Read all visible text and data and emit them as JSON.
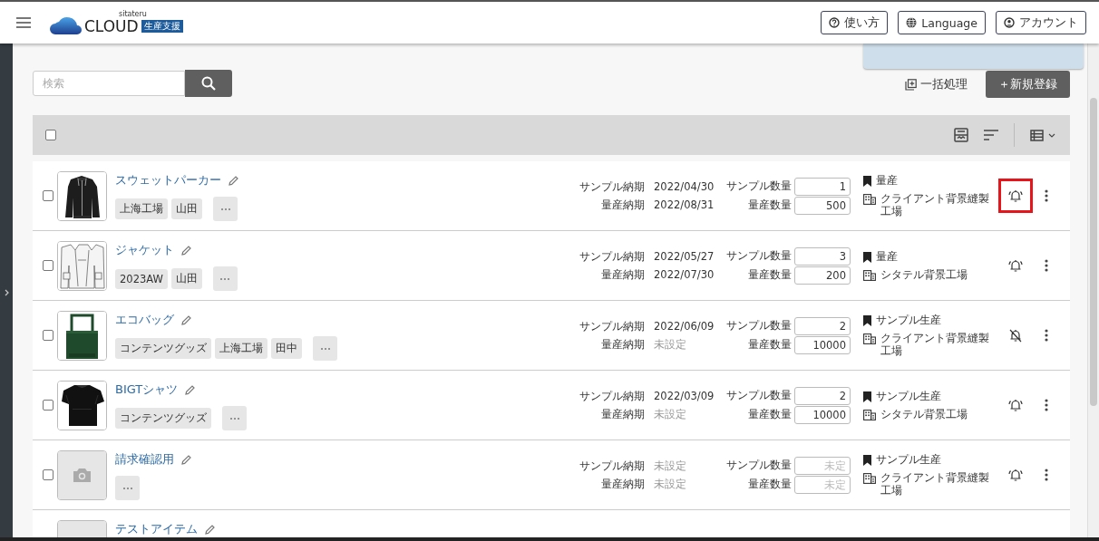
{
  "header": {
    "logo": {
      "small": "sitateru",
      "main": "CLOUD",
      "badge": "生産支援"
    },
    "buttons": [
      {
        "kind": "help",
        "label": "使い方"
      },
      {
        "kind": "language",
        "label": "Language"
      },
      {
        "kind": "account",
        "label": "アカウント"
      }
    ]
  },
  "toolbar": {
    "search": {
      "placeholder": "検索"
    },
    "bulk_action": "一括処理",
    "new_button": "＋新規登録"
  },
  "table_header": {
    "checked": false
  },
  "rows": [
    {
      "checked": false,
      "image": {
        "kind": "picture"
      },
      "name": "スウェットパーカー",
      "tags": [
        "上海工場",
        "山田"
      ],
      "sample_due_label": "サンプル納期",
      "sample_due": {
        "value": "2022/04/30",
        "unset": false
      },
      "mass_due_label": "量産納期",
      "mass_due": {
        "value": "2022/08/31",
        "unset": false
      },
      "sample_qty_label": "サンプル数量",
      "sample_qty": {
        "value": "1"
      },
      "mass_qty_label": "量産数量",
      "mass_qty": {
        "value": "500"
      },
      "category": "量産",
      "factory": "クライアント背景縫製工場",
      "notify": true,
      "highlighted": true
    },
    {
      "checked": false,
      "image": {
        "kind": "picture"
      },
      "name": "ジャケット",
      "tags": [
        "2023AW",
        "山田"
      ],
      "sample_due_label": "サンプル納期",
      "sample_due": {
        "value": "2022/05/27",
        "unset": false
      },
      "mass_due_label": "量産納期",
      "mass_due": {
        "value": "2022/07/30",
        "unset": false
      },
      "sample_qty_label": "サンプル数量",
      "sample_qty": {
        "value": "3"
      },
      "mass_qty_label": "量産数量",
      "mass_qty": {
        "value": "200"
      },
      "category": "量産",
      "factory": "シタテル背景工場",
      "notify": true,
      "highlighted": false
    },
    {
      "checked": false,
      "image": {
        "kind": "picture"
      },
      "name": "エコバッグ",
      "tags": [
        "コンテンツグッズ",
        "上海工場",
        "田中"
      ],
      "sample_due_label": "サンプル納期",
      "sample_due": {
        "value": "2022/06/09",
        "unset": false
      },
      "mass_due_label": "量産納期",
      "mass_due": {
        "value": "未設定",
        "unset": true
      },
      "sample_qty_label": "サンプル数量",
      "sample_qty": {
        "value": "2"
      },
      "mass_qty_label": "量産数量",
      "mass_qty": {
        "value": "10000"
      },
      "category": "サンプル生産",
      "factory": "クライアント背景縫製工場",
      "notify": false,
      "highlighted": false
    },
    {
      "checked": false,
      "image": {
        "kind": "picture"
      },
      "name": "BIGTシャツ",
      "tags": [
        "コンテンツグッズ"
      ],
      "sample_due_label": "サンプル納期",
      "sample_due": {
        "value": "2022/03/09",
        "unset": false
      },
      "mass_due_label": "量産納期",
      "mass_due": {
        "value": "未設定",
        "unset": true
      },
      "sample_qty_label": "サンプル数量",
      "sample_qty": {
        "value": "2"
      },
      "mass_qty_label": "量産数量",
      "mass_qty": {
        "value": "10000"
      },
      "category": "サンプル生産",
      "factory": "シタテル背景工場",
      "notify": true,
      "highlighted": false
    },
    {
      "checked": false,
      "image": {
        "kind": "placeholder"
      },
      "name": "請求確認用",
      "tags": [],
      "sample_due_label": "サンプル納期",
      "sample_due": {
        "value": "未設定",
        "unset": true
      },
      "mass_due_label": "量産納期",
      "mass_due": {
        "value": "未設定",
        "unset": true
      },
      "sample_qty_label": "サンプル数量",
      "sample_qty": {
        "placeholder": "未定"
      },
      "mass_qty_label": "量産数量",
      "mass_qty": {
        "placeholder": "未定"
      },
      "category": "サンプル生産",
      "factory": "クライアント背景縫製工場",
      "notify": true,
      "highlighted": false
    },
    {
      "image": {
        "kind": "placeholder"
      },
      "name": "テストアイテム"
    }
  ]
}
